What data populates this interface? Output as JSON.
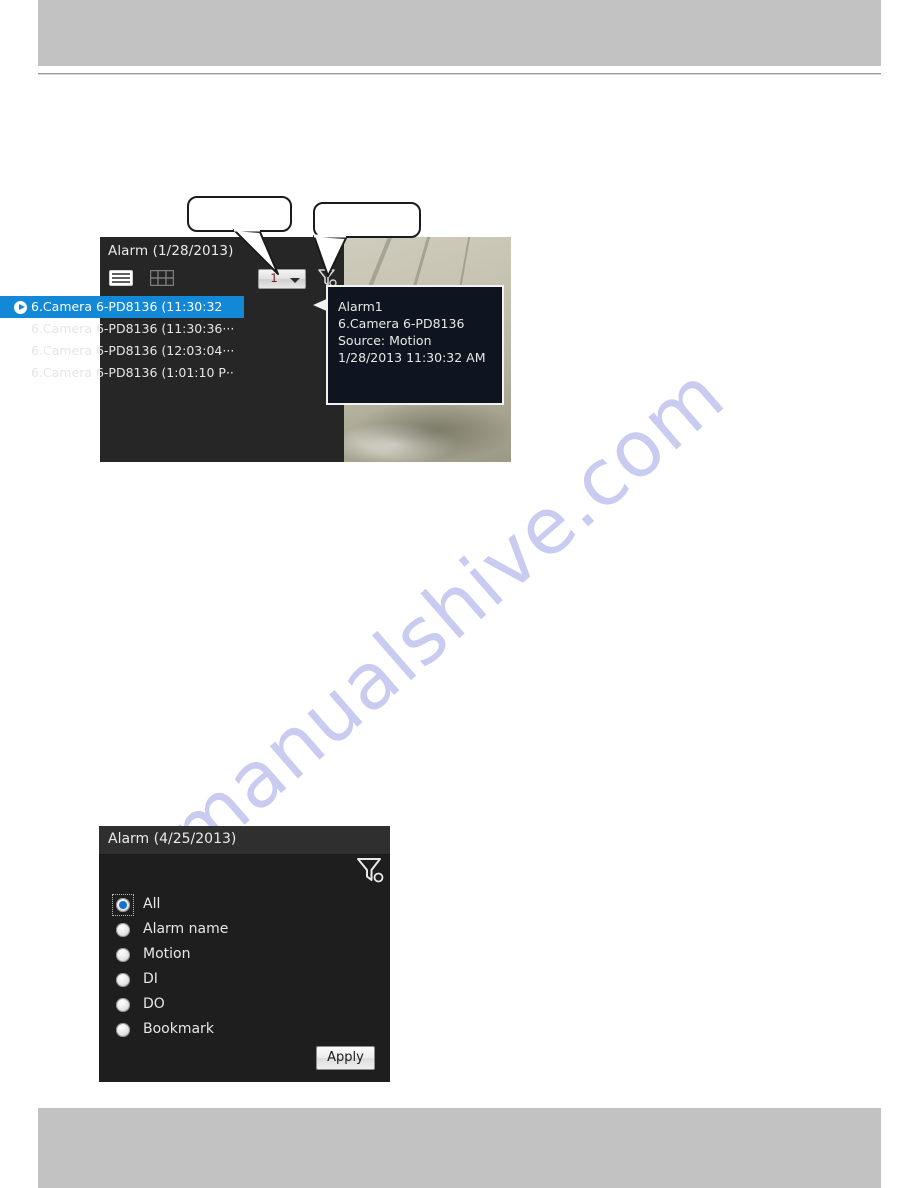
{
  "page": {
    "watermark": "manualshive.com",
    "watermark_color": "#c9cbf0"
  },
  "callouts": [
    {
      "name": "callout-left",
      "label": ""
    },
    {
      "name": "callout-right",
      "label": ""
    }
  ],
  "alarm_panel": {
    "title": "Alarm (1/28/2013)",
    "toolbar": {
      "list_view_icon": "list-view-icon",
      "grid_view_icon": "grid-view-icon",
      "page_select_value": "1",
      "page_select_caret": "chevron-down-icon",
      "filter_icon": "filter-settings-icon"
    },
    "rows": [
      {
        "text": "6.Camera 6-PD8136 (11:30:32",
        "selected": true,
        "play_icon": "play-icon"
      },
      {
        "text": "6.Camera 6-PD8136 (11:30:36···",
        "selected": false,
        "play_icon": ""
      },
      {
        "text": "6.Camera 6-PD8136 (12:03:04···",
        "selected": false,
        "play_icon": ""
      },
      {
        "text": "6.Camera 6-PD8136 (1:01:10 P··",
        "selected": false,
        "play_icon": ""
      }
    ],
    "tooltip": {
      "lines": [
        "Alarm1",
        "6.Camera 6-PD8136",
        "Source: Motion",
        "1/28/2013 11:30:32 AM"
      ]
    },
    "accent_color": "#1288d6"
  },
  "filter_panel": {
    "title": "Alarm (4/25/2013)",
    "filter_icon": "filter-settings-icon",
    "options": [
      {
        "label": "All",
        "checked": true
      },
      {
        "label": "Alarm name",
        "checked": false
      },
      {
        "label": "Motion",
        "checked": false
      },
      {
        "label": "DI",
        "checked": false
      },
      {
        "label": "DO",
        "checked": false
      },
      {
        "label": "Bookmark",
        "checked": false
      }
    ],
    "apply_label": "Apply",
    "radio_accent": "#1773d0"
  }
}
